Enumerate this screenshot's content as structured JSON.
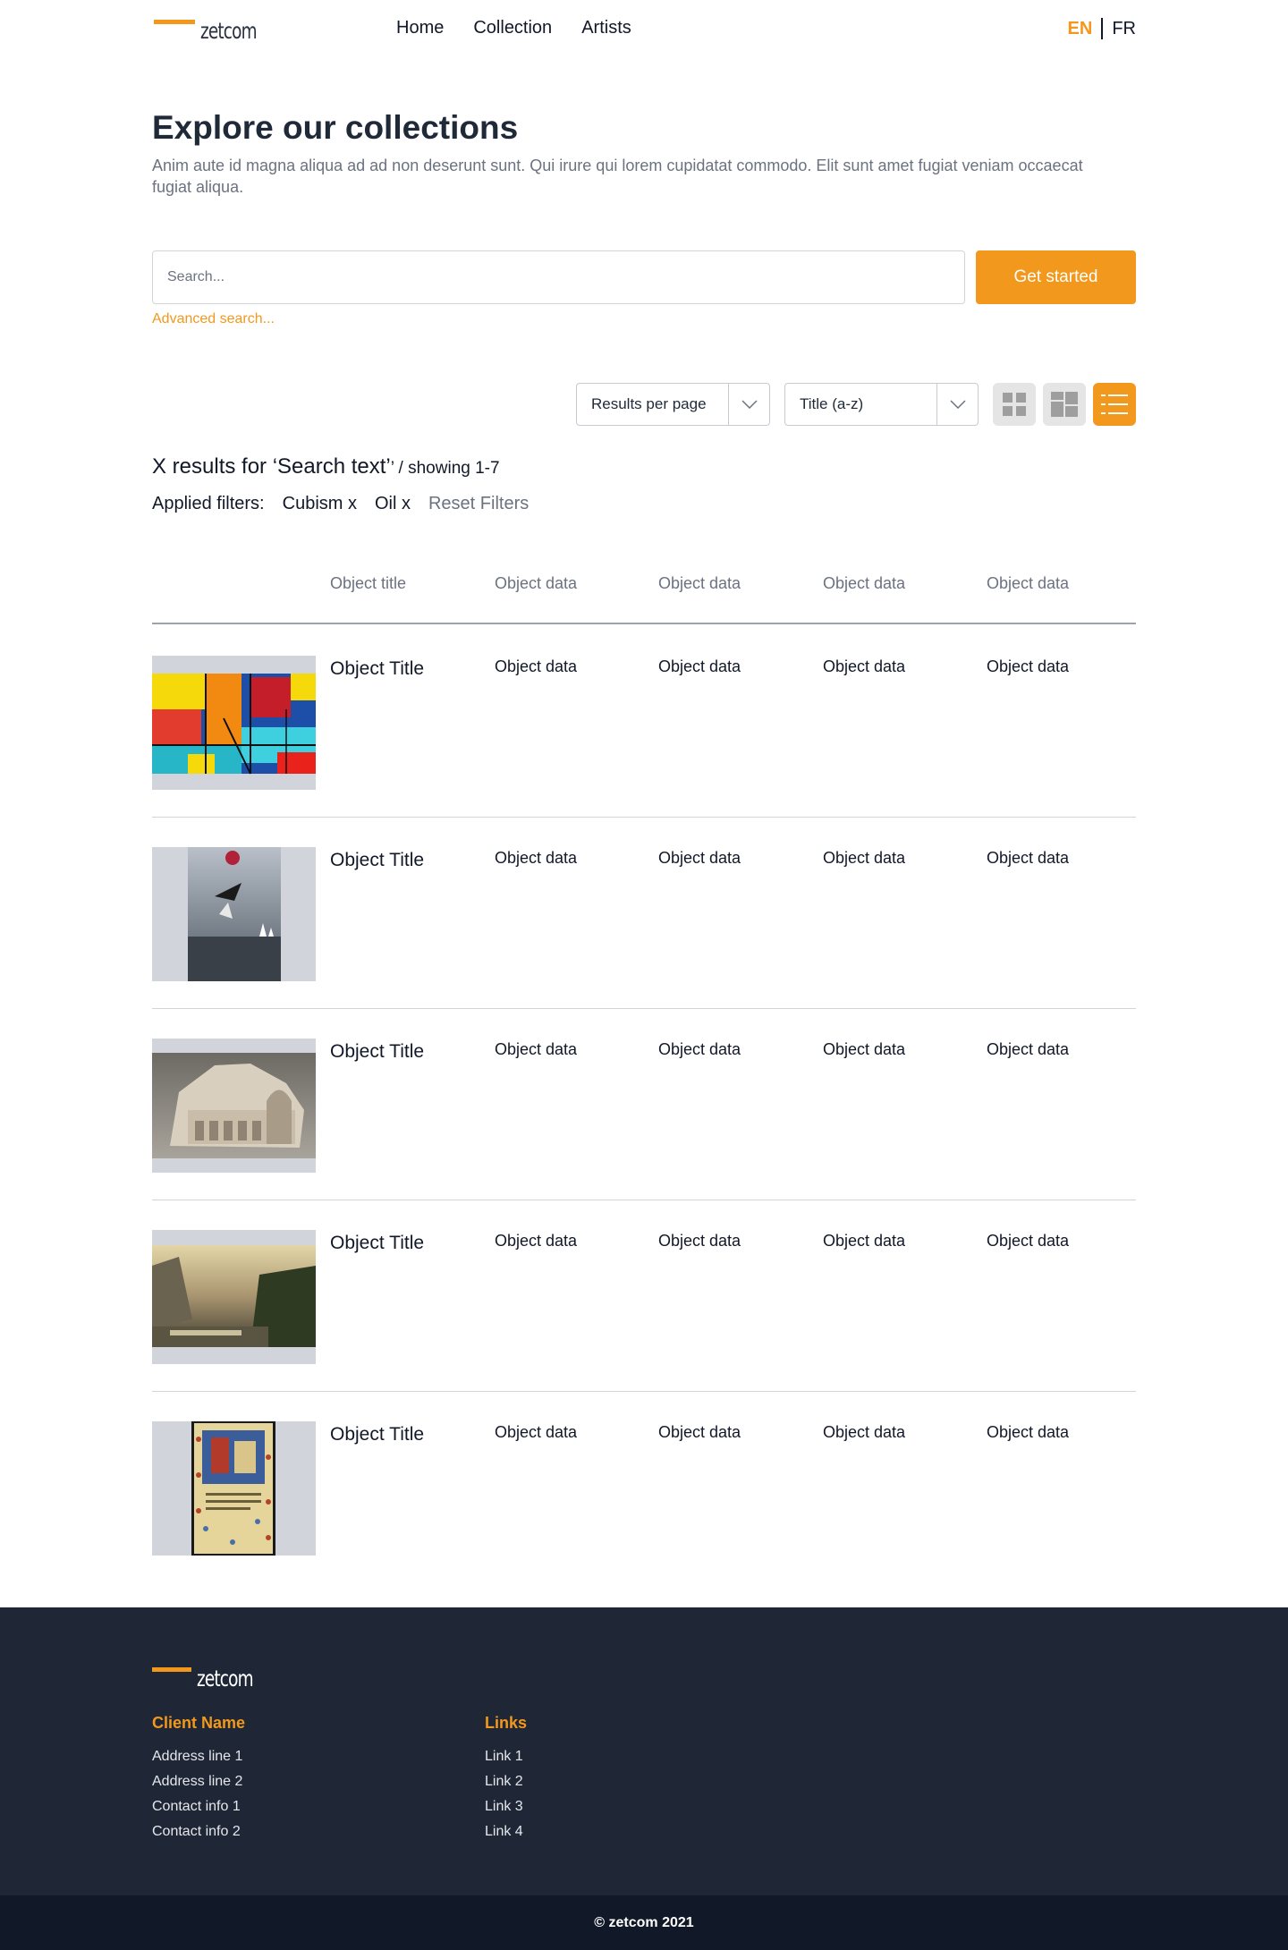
{
  "brand": {
    "name": "zetcom",
    "accent": "#f2981d",
    "dark": "#1f2737"
  },
  "nav": {
    "items": [
      "Home",
      "Collection",
      "Artists"
    ]
  },
  "lang": {
    "active": "EN",
    "other": "FR"
  },
  "hero": {
    "title": "Explore our collections",
    "subtitle": "Anim aute id magna aliqua ad ad non deserunt sunt. Qui irure qui lorem cupidatat commodo. Elit sunt amet fugiat veniam occaecat fugiat aliqua."
  },
  "search": {
    "placeholder": "Search...",
    "button": "Get started",
    "advanced": "Advanced search..."
  },
  "controls": {
    "results_per_page": "Results per page",
    "sort": "Title (a-z)",
    "views": [
      "grid-view-icon",
      "mosaic-view-icon",
      "list-view-icon"
    ],
    "active_view": "list"
  },
  "results": {
    "text": "X results for ‘Search text’",
    "showing": "’ / showing 1-7"
  },
  "filters": {
    "label": "Applied filters:",
    "items": [
      "Cubism x",
      "Oil x"
    ],
    "reset": "Reset Filters"
  },
  "table": {
    "headers": [
      "Object title",
      "Object data",
      "Object data",
      "Object data",
      "Object data"
    ],
    "rows": [
      {
        "title": "Object Title",
        "data": [
          "Object data",
          "Object data",
          "Object data",
          "Object data"
        ],
        "image": "abstract-painting"
      },
      {
        "title": "Object Title",
        "data": [
          "Object data",
          "Object data",
          "Object data",
          "Object data"
        ],
        "image": "surreal-photo"
      },
      {
        "title": "Object Title",
        "data": [
          "Object data",
          "Object data",
          "Object data",
          "Object data"
        ],
        "image": "stone-carving"
      },
      {
        "title": "Object Title",
        "data": [
          "Object data",
          "Object data",
          "Object data",
          "Object data"
        ],
        "image": "landscape-painting"
      },
      {
        "title": "Object Title",
        "data": [
          "Object data",
          "Object data",
          "Object data",
          "Object data"
        ],
        "image": "illuminated-manuscript"
      }
    ]
  },
  "footer": {
    "client": {
      "heading": "Client Name",
      "lines": [
        "Address line 1",
        "Address line 2",
        "Contact info 1",
        "Contact info 2"
      ]
    },
    "links": {
      "heading": "Links",
      "lines": [
        "Link 1",
        "Link 2",
        "Link 3",
        "Link 4"
      ]
    },
    "copyright": "© zetcom 2021"
  }
}
